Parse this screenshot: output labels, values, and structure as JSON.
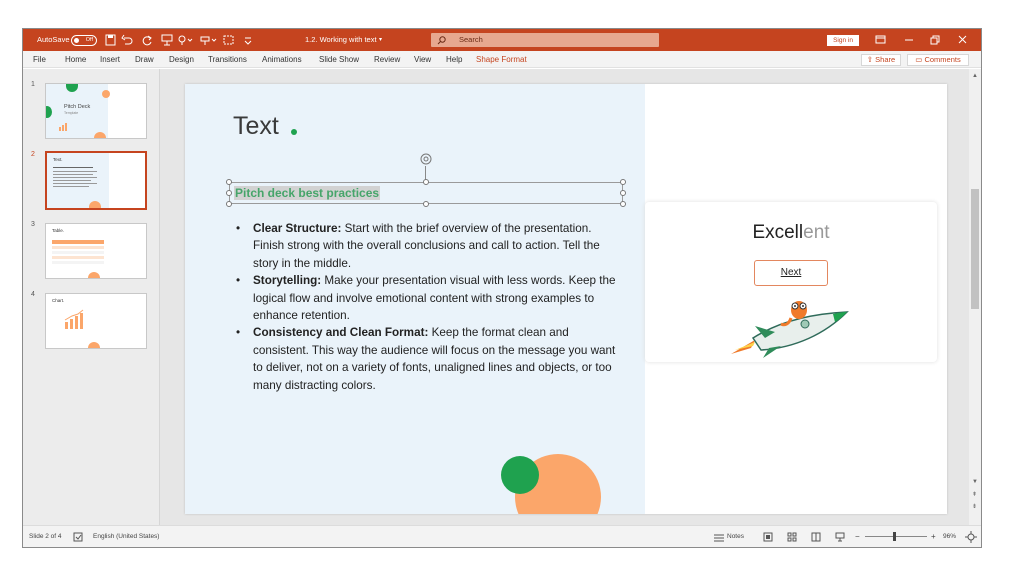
{
  "titlebar": {
    "autosave_label": "AutoSave",
    "autosave_state": "Off",
    "doc_title": "1.2. Working with text",
    "search_placeholder": "Search",
    "signin_label": "Sign in"
  },
  "menu": [
    "File",
    "Home",
    "Insert",
    "Draw",
    "Design",
    "Transitions",
    "Animations",
    "Slide Show",
    "Review",
    "View",
    "Help",
    "Shape Format"
  ],
  "menu_share": "Share",
  "menu_comments": "Comments",
  "thumbnails": [
    {
      "num": "1",
      "title": "Pitch Deck",
      "sub": "Template"
    },
    {
      "num": "2",
      "title": "Text."
    },
    {
      "num": "3",
      "title": "Table."
    },
    {
      "num": "4",
      "title": "Chart."
    }
  ],
  "slide": {
    "title": "Text",
    "subtitle": "Pitch deck best practices",
    "bullets": [
      {
        "bold": "Clear Structure:",
        "text": " Start with the brief overview of the presentation. Finish strong with the overall conclusions and call to action. Tell the story in the middle."
      },
      {
        "bold": "Storytelling:",
        "text": " Make your presentation visual with less words. Keep the logical flow and involve emotional content with strong examples to enhance retention."
      },
      {
        "bold": "Consistency and Clean Format:",
        "text": " Keep the format clean and consistent. This way the audience will focus on the message you want to deliver, not on a variety of fonts, unaligned lines and objects, or too many distracting colors."
      }
    ],
    "card_word_dark": "Excell",
    "card_word_light": "ent",
    "next_label": "Next"
  },
  "status": {
    "slide_info": "Slide 2 of 4",
    "language": "English (United States)",
    "notes": "Notes",
    "zoom": "96%"
  },
  "colors": {
    "accent": "#c5441f",
    "green": "#1fa24f",
    "orange": "#fba66a",
    "panel": "#eaf3fa"
  }
}
